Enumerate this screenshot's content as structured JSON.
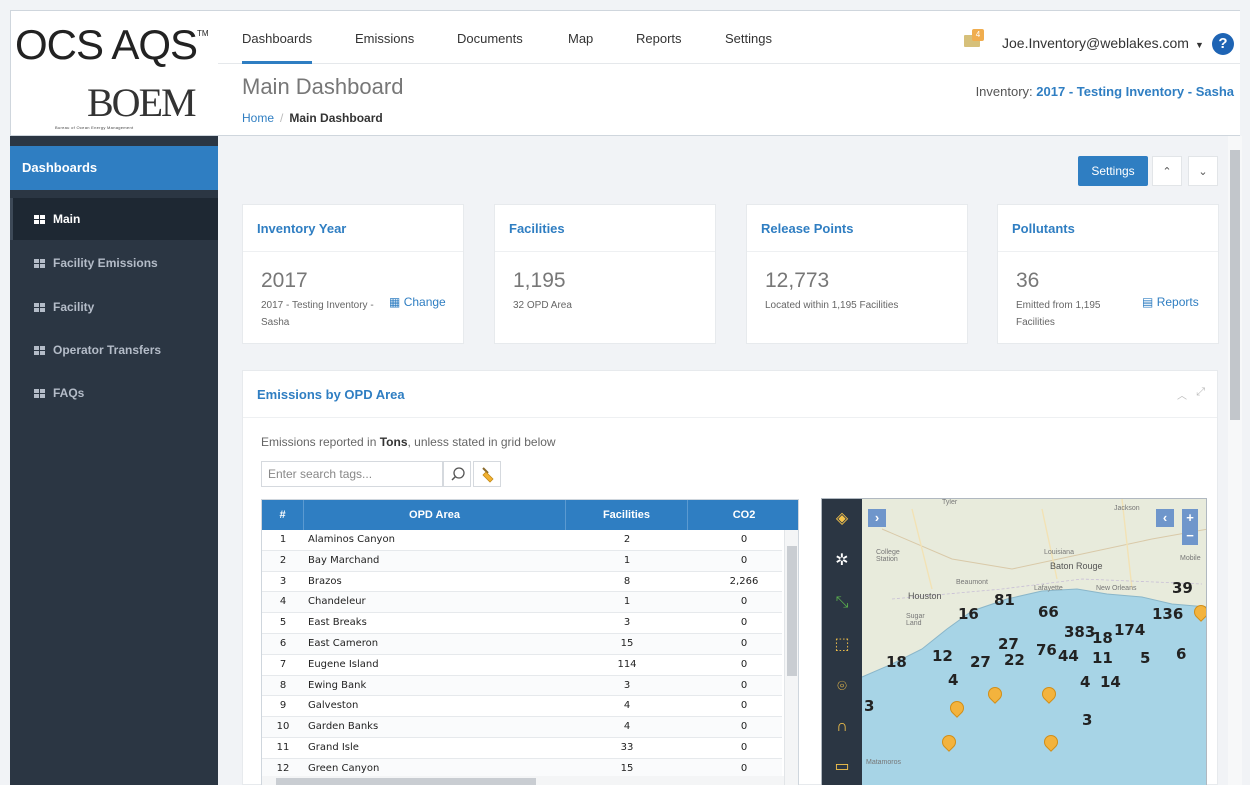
{
  "logo": {
    "ocs": "OCS AQS",
    "tm": "TM",
    "boem": "BOEM",
    "boem_sub": "Bureau of Ocean Energy Management"
  },
  "nav": {
    "items": [
      "Dashboards",
      "Emissions",
      "Documents",
      "Map",
      "Reports",
      "Settings"
    ],
    "active": "Dashboards",
    "mail_badge": "4",
    "user": "Joe.Inventory@weblakes.com",
    "help": "?"
  },
  "header": {
    "title": "Main Dashboard",
    "breadcrumb": {
      "home": "Home",
      "sep": "/",
      "current": "Main Dashboard"
    },
    "inventory_label": "Inventory:",
    "inventory_value": "2017 - Testing Inventory - Sasha"
  },
  "sidebar": {
    "header": "Dashboards",
    "items": [
      "Main",
      "Facility Emissions",
      "Facility",
      "Operator Transfers",
      "FAQs"
    ],
    "active": "Main"
  },
  "toolbar": {
    "settings_label": "Settings"
  },
  "cards": [
    {
      "title": "Inventory Year",
      "value": "2017",
      "desc": "2017 - Testing Inventory - Sasha",
      "link": "Change"
    },
    {
      "title": "Facilities",
      "value": "1,195",
      "desc": "32 OPD Area"
    },
    {
      "title": "Release Points",
      "value": "12,773",
      "desc": "Located within 1,195 Facilities"
    },
    {
      "title": "Pollutants",
      "value": "36",
      "desc": "Emitted from 1,195 Facilities",
      "link": "Reports"
    }
  ],
  "emissions": {
    "title": "Emissions by OPD Area",
    "note_prefix": "Emissions reported in ",
    "note_unit": "Tons",
    "note_suffix": ", unless stated in grid below",
    "search_placeholder": "Enter search tags...",
    "columns": [
      "#",
      "OPD Area",
      "Facilities",
      "CO2"
    ],
    "rows": [
      [
        "1",
        "Alaminos Canyon",
        "2",
        "0"
      ],
      [
        "2",
        "Bay Marchand",
        "1",
        "0"
      ],
      [
        "3",
        "Brazos",
        "8",
        "2,266"
      ],
      [
        "4",
        "Chandeleur",
        "1",
        "0"
      ],
      [
        "5",
        "East Breaks",
        "3",
        "0"
      ],
      [
        "6",
        "East Cameron",
        "15",
        "0"
      ],
      [
        "7",
        "Eugene Island",
        "114",
        "0"
      ],
      [
        "8",
        "Ewing Bank",
        "3",
        "0"
      ],
      [
        "9",
        "Galveston",
        "4",
        "0"
      ],
      [
        "10",
        "Garden Banks",
        "4",
        "0"
      ],
      [
        "11",
        "Grand Isle",
        "33",
        "0"
      ],
      [
        "12",
        "Green Canyon",
        "15",
        "0"
      ]
    ]
  },
  "map": {
    "cities": [
      "Tyler",
      "Jackson",
      "College Station",
      "Louisiana",
      "Baton Rouge",
      "Mobile",
      "Beaumont",
      "Lafayette",
      "New Orleans",
      "Houston",
      "Sugar Land",
      "Matamoros"
    ],
    "clusters": [
      "16",
      "81",
      "66",
      "39",
      "136",
      "383",
      "18",
      "174",
      "27",
      "76",
      "44",
      "12",
      "27",
      "22",
      "11",
      "5",
      "6",
      "18",
      "4",
      "4",
      "14",
      "3",
      "3"
    ]
  }
}
